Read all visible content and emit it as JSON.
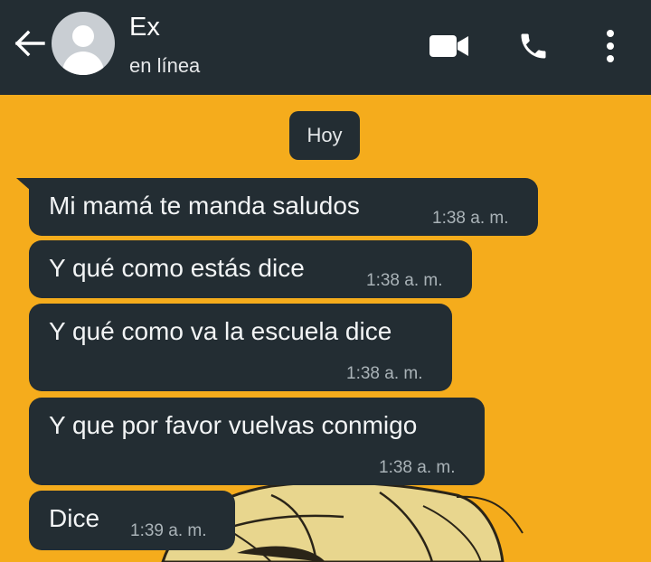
{
  "header": {
    "contact_name": "Ex",
    "status": "en línea",
    "icons": [
      "back-arrow-icon",
      "video-call-icon",
      "phone-call-icon",
      "more-options-icon"
    ]
  },
  "chat": {
    "date_label": "Hoy",
    "messages": [
      {
        "text": "Mi mamá te manda saludos",
        "time": "1:38 a. m."
      },
      {
        "text": "Y qué como estás dice",
        "time": "1:38 a. m."
      },
      {
        "text": "Y qué como va la escuela dice",
        "time": "1:38 a. m."
      },
      {
        "text": "Y que por favor vuelvas conmigo",
        "time": "1:38 a. m."
      },
      {
        "text": "Dice",
        "time": "1:39 a. m."
      }
    ]
  },
  "colors": {
    "header_bg": "#232d33",
    "bubble_bg": "#232d33",
    "wallpaper": "#f5ac1c",
    "timestamp": "#aab3b8"
  }
}
